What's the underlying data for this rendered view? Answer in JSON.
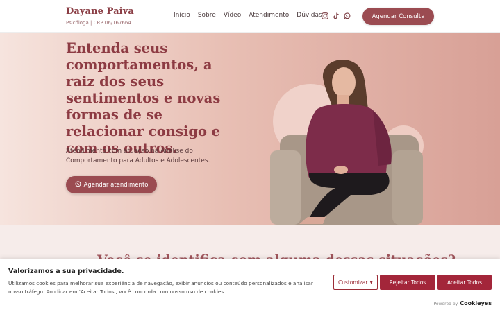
{
  "header": {
    "brand_name": "Dayane Paiva",
    "brand_subtitle": "Psicóloga | CRP 06/167664",
    "nav": [
      "Início",
      "Sobre",
      "Vídeo",
      "Atendimento",
      "Dúvidas"
    ],
    "social_icons": [
      "instagram-icon",
      "tiktok-icon",
      "whatsapp-icon"
    ],
    "cta_label": "Agendar Consulta"
  },
  "hero": {
    "title": "Entenda seus comportamentos, a raiz dos seus sentimentos e novas formas de se relacionar consigo e com os outros.",
    "description": "Atendimento com atuação na Análise do Comportamento para Adultos e Adolescentes.",
    "cta_label": "Agendar atendimento",
    "cta_icon": "whatsapp-icon"
  },
  "section2": {
    "title": "Você se identifica com alguma dessas situações?"
  },
  "cookie": {
    "title": "Valorizamos a sua privacidade.",
    "text": "Utilizamos cookies para melhorar sua experiência de navegação, exibir anúncios ou conteúdo personalizados e analisar nosso tráfego. Ao clicar em 'Aceitar Todos', você concorda com nosso uso de cookies.",
    "customize_label": "Customizar",
    "reject_label": "Rejeitar Todos",
    "accept_label": "Aceitar Todos",
    "powered_by": "Powered by",
    "powered_logo": "Cookieyes"
  },
  "colors": {
    "brand": "#9b4b51",
    "title": "#8d3b43",
    "cookie_button": "#a3263a"
  }
}
